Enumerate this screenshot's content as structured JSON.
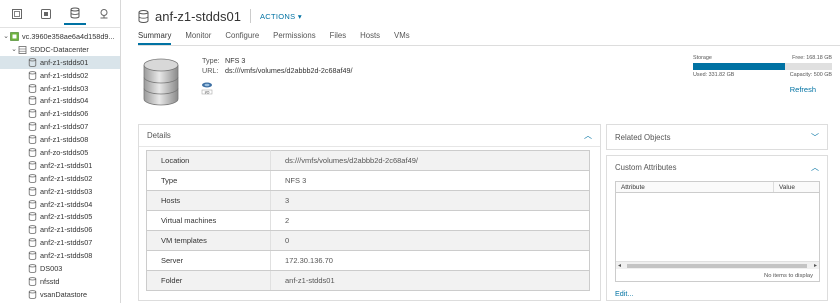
{
  "navigator": {
    "tabs": [
      "hosts-clusters-icon",
      "vms-templates-icon",
      "storage-icon",
      "networking-icon"
    ],
    "tree": [
      {
        "label": "vc.3960e358ae6a4d158d9...",
        "level": 0,
        "icon": "vcenter-icon",
        "expanded": true
      },
      {
        "label": "SDDC-Datacenter",
        "level": 1,
        "icon": "datacenter-icon",
        "expanded": true
      },
      {
        "label": "anf-z1-stdds01",
        "level": 2,
        "icon": "datastore-icon",
        "selected": true
      },
      {
        "label": "anf-z1-stdds02",
        "level": 2,
        "icon": "datastore-icon"
      },
      {
        "label": "anf-z1-stdds03",
        "level": 2,
        "icon": "datastore-icon"
      },
      {
        "label": "anf-z1-stdds04",
        "level": 2,
        "icon": "datastore-icon"
      },
      {
        "label": "anf-z1-stdds06",
        "level": 2,
        "icon": "datastore-icon"
      },
      {
        "label": "anf-z1-stdds07",
        "level": 2,
        "icon": "datastore-icon"
      },
      {
        "label": "anf-z1-stdds08",
        "level": 2,
        "icon": "datastore-icon"
      },
      {
        "label": "anf-zo-stdds05",
        "level": 2,
        "icon": "datastore-icon"
      },
      {
        "label": "anf2-z1-stdds01",
        "level": 2,
        "icon": "datastore-icon"
      },
      {
        "label": "anf2-z1-stdds02",
        "level": 2,
        "icon": "datastore-icon"
      },
      {
        "label": "anf2-z1-stdds03",
        "level": 2,
        "icon": "datastore-icon"
      },
      {
        "label": "anf2-z1-stdds04",
        "level": 2,
        "icon": "datastore-icon"
      },
      {
        "label": "anf2-z1-stdds05",
        "level": 2,
        "icon": "datastore-icon"
      },
      {
        "label": "anf2-z1-stdds06",
        "level": 2,
        "icon": "datastore-icon"
      },
      {
        "label": "anf2-z1-stdds07",
        "level": 2,
        "icon": "datastore-icon"
      },
      {
        "label": "anf2-z1-stdds08",
        "level": 2,
        "icon": "datastore-icon"
      },
      {
        "label": "DS003",
        "level": 2,
        "icon": "datastore-icon"
      },
      {
        "label": "nfsstd",
        "level": 2,
        "icon": "datastore-icon"
      },
      {
        "label": "vsanDatastore",
        "level": 2,
        "icon": "datastore-icon"
      }
    ]
  },
  "header": {
    "title": "anf-z1-stdds01",
    "actions_label": "ACTIONS",
    "tabs": [
      "Summary",
      "Monitor",
      "Configure",
      "Permissions",
      "Files",
      "Hosts",
      "VMs"
    ],
    "active_tab": "Summary"
  },
  "summary": {
    "type_label": "Type:",
    "type_value": "NFS 3",
    "url_label": "URL:",
    "url_value": "ds:///vmfs/volumes/d2abbb2d-2c68af49/",
    "storage": {
      "label": "Storage",
      "free": "Free: 168.18 GB",
      "used": "Used: 331.82 GB",
      "capacity": "Capacity: 500 GB",
      "used_fraction": 0.6636,
      "color": "#0072a3"
    },
    "refresh_label": "Refresh"
  },
  "details": {
    "title": "Details",
    "rows": [
      {
        "key": "Location",
        "value": "ds:///vmfs/volumes/d2abbb2d-2c68af49/"
      },
      {
        "key": "Type",
        "value": "NFS 3"
      },
      {
        "key": "Hosts",
        "value": "3"
      },
      {
        "key": "Virtual machines",
        "value": "2"
      },
      {
        "key": "VM templates",
        "value": "0"
      },
      {
        "key": "Server",
        "value": "172.30.136.70"
      },
      {
        "key": "Folder",
        "value": "anf-z1-stdds01"
      }
    ]
  },
  "related_objects": {
    "title": "Related Objects"
  },
  "custom_attributes": {
    "title": "Custom Attributes",
    "columns": [
      "Attribute",
      "Value"
    ],
    "empty_text": "No items to display",
    "edit_label": "Edit..."
  }
}
